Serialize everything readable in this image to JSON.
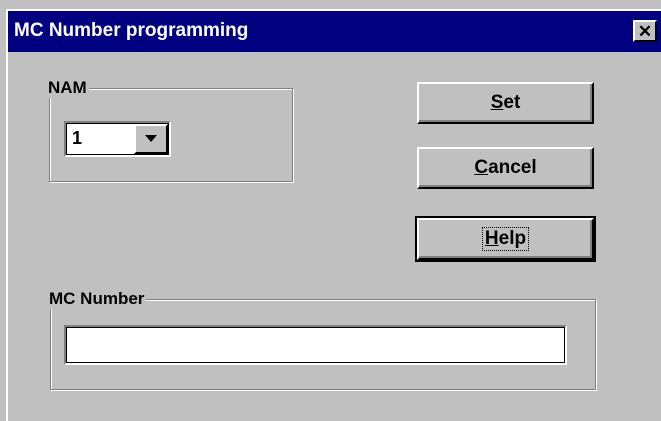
{
  "window": {
    "title": "MC Number programming",
    "close_glyph": "✕"
  },
  "nam_group": {
    "label": "NAM",
    "combo_value": "1"
  },
  "mc_group": {
    "label": "MC Number",
    "field_value": ""
  },
  "buttons": {
    "set": {
      "mnemonic": "S",
      "rest": "et"
    },
    "cancel": {
      "mnemonic": "C",
      "rest": "ancel"
    },
    "help": {
      "mnemonic": "H",
      "rest": "elp"
    }
  },
  "colors": {
    "titlebar": "#000080",
    "face": "#c0c0c0"
  },
  "icons": {
    "close": "close-icon",
    "dropdown": "chevron-down-icon"
  }
}
